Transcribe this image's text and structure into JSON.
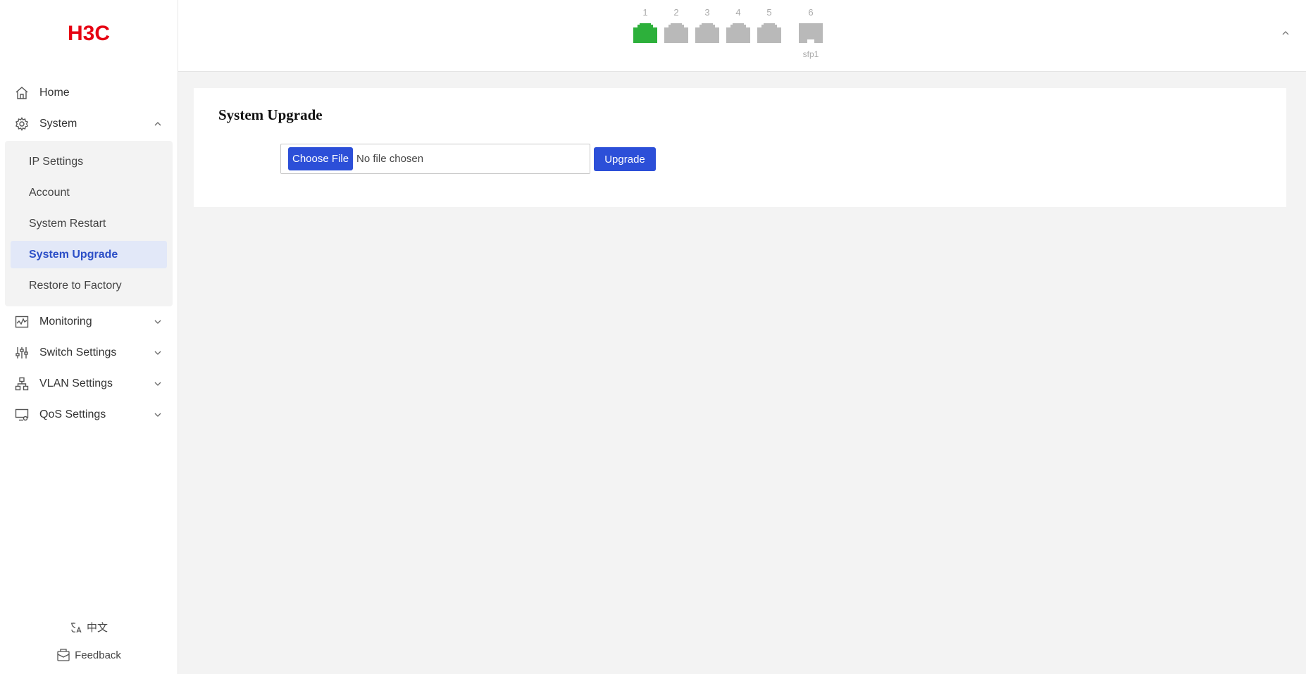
{
  "brand": {
    "logo_text": "H3C",
    "color": "#e60012"
  },
  "sidebar": {
    "items": [
      {
        "label": "Home",
        "icon": "home-icon"
      },
      {
        "label": "System",
        "icon": "gear-icon",
        "expanded": true
      },
      {
        "label": "Monitoring",
        "icon": "monitoring-icon"
      },
      {
        "label": "Switch Settings",
        "icon": "sliders-icon"
      },
      {
        "label": "VLAN Settings",
        "icon": "network-icon"
      },
      {
        "label": "QoS Settings",
        "icon": "qos-icon"
      }
    ],
    "system_submenu": [
      {
        "label": "IP Settings"
      },
      {
        "label": "Account"
      },
      {
        "label": "System Restart"
      },
      {
        "label": "System Upgrade",
        "active": true
      },
      {
        "label": "Restore to Factory"
      }
    ],
    "footer": {
      "language_label": "中文",
      "feedback_label": "Feedback"
    }
  },
  "header": {
    "ports": [
      {
        "number": "1",
        "status": "up"
      },
      {
        "number": "2",
        "status": "down"
      },
      {
        "number": "3",
        "status": "down"
      },
      {
        "number": "4",
        "status": "down"
      },
      {
        "number": "5",
        "status": "down"
      },
      {
        "number": "6",
        "status": "down",
        "sub_label": "sfp1"
      }
    ],
    "colors": {
      "port_up": "#2db03b",
      "port_down": "#b9b9b9"
    }
  },
  "main": {
    "title": "System Upgrade",
    "choose_file_label": "Choose File",
    "file_status": "No file chosen",
    "upgrade_label": "Upgrade"
  },
  "theme": {
    "accent": "#2c4fd8",
    "active_bg": "#e2e8f8",
    "active_text": "#2c4fc7"
  }
}
